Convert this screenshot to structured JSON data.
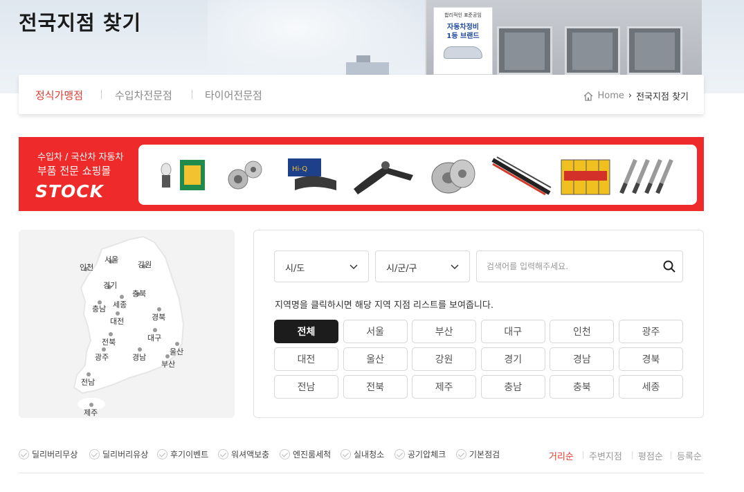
{
  "page": {
    "title": "전국지점 찾기"
  },
  "hero": {
    "sign_line1": "합리적인 표준공임",
    "sign_line2": "자동차정비",
    "sign_line3": "1등 브랜드"
  },
  "tabs": [
    {
      "label": "정식가맹점",
      "active": true
    },
    {
      "label": "수입차전문점",
      "active": false
    },
    {
      "label": "타이어전문점",
      "active": false
    }
  ],
  "breadcrumb": {
    "home": "Home",
    "separator": "›",
    "current": "전국지점 찾기"
  },
  "banner": {
    "line1": "수입차 / 국산차 자동차",
    "line2": "부품 전문 쇼핑몰",
    "logo": "STOCK",
    "background": "#ee2b2a"
  },
  "map": {
    "regions": [
      "인천",
      "서울",
      "강원",
      "경기",
      "충북",
      "충남",
      "세종",
      "대전",
      "경북",
      "전북",
      "대구",
      "광주",
      "경남",
      "울산",
      "부산",
      "전남",
      "제주"
    ]
  },
  "search": {
    "sido_label": "시/도",
    "sigungu_label": "시/군/구",
    "placeholder": "검색어를 입력해주세요.",
    "hint": "지역명을 클릭하시면 해당 지역 지점 리스트를 보여줍니다."
  },
  "region_buttons": [
    {
      "label": "전체",
      "active": true
    },
    {
      "label": "서울"
    },
    {
      "label": "부산"
    },
    {
      "label": "대구"
    },
    {
      "label": "인천"
    },
    {
      "label": "광주"
    },
    {
      "label": "대전"
    },
    {
      "label": "울산"
    },
    {
      "label": "강원"
    },
    {
      "label": "경기"
    },
    {
      "label": "경남"
    },
    {
      "label": "경북"
    },
    {
      "label": "전남"
    },
    {
      "label": "전북"
    },
    {
      "label": "제주"
    },
    {
      "label": "충남"
    },
    {
      "label": "충북"
    },
    {
      "label": "세종"
    }
  ],
  "filters": [
    "딜리버리무상",
    "딜리버리유상",
    "후기이벤트",
    "워셔액보충",
    "엔진룸세척",
    "실내청소",
    "공기압체크",
    "기본점검"
  ],
  "sort": [
    {
      "label": "거리순",
      "active": true
    },
    {
      "label": "주변지점"
    },
    {
      "label": "평점순"
    },
    {
      "label": "등록순"
    }
  ],
  "colors": {
    "accent": "#e03a2e",
    "active_button": "#1c1c1c"
  }
}
